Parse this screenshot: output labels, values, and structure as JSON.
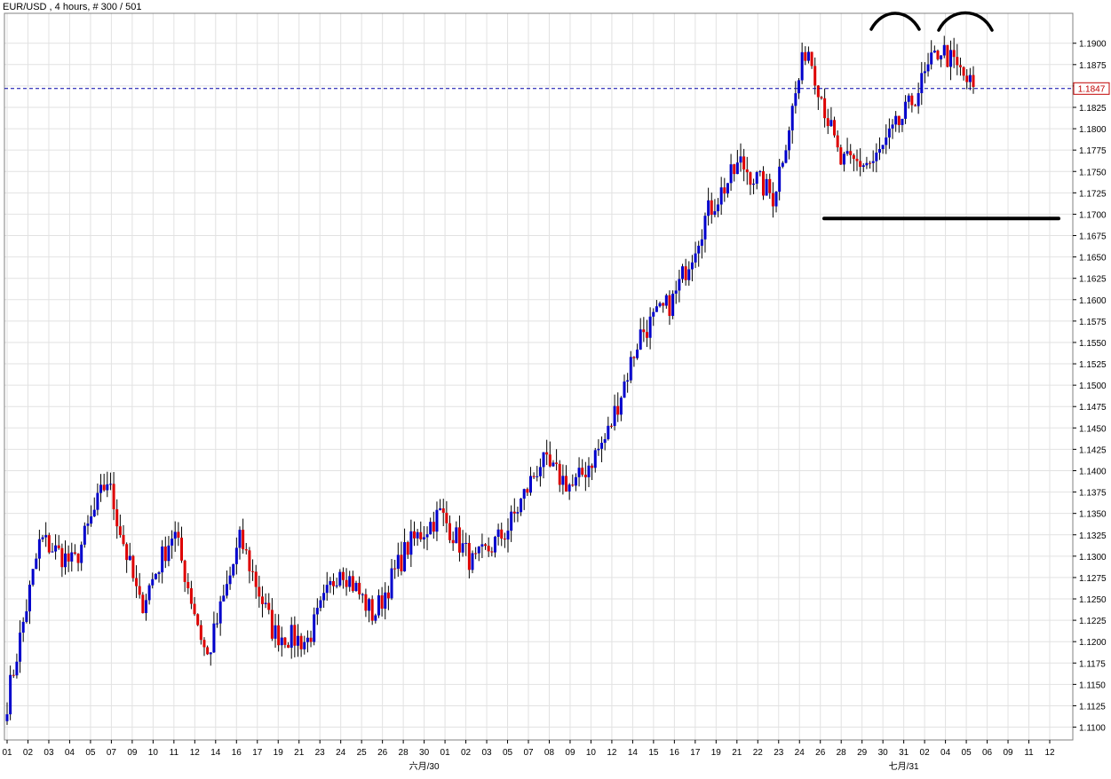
{
  "chart_data": {
    "type": "candlestick",
    "title": "EUR/USD , 4 hours, # 300 / 501",
    "symbol": "EUR/USD",
    "timeframe": "4 hours",
    "bars_info": "# 300 / 501",
    "ylim": [
      1.1085,
      1.1935
    ],
    "y_ticks": [
      "1.1900",
      "1.1875",
      "1.1850",
      "1.1825",
      "1.1800",
      "1.1775",
      "1.1750",
      "1.1725",
      "1.1700",
      "1.1675",
      "1.1650",
      "1.1625",
      "1.1600",
      "1.1575",
      "1.1550",
      "1.1525",
      "1.1500",
      "1.1475",
      "1.1450",
      "1.1425",
      "1.1400",
      "1.1375",
      "1.1350",
      "1.1325",
      "1.1300",
      "1.1275",
      "1.1250",
      "1.1225",
      "1.1200",
      "1.1175",
      "1.1150",
      "1.1125",
      "1.1100"
    ],
    "x_tick_labels": [
      "01",
      "02",
      "03",
      "04",
      "05",
      "07",
      "09",
      "10",
      "11",
      "12",
      "14",
      "16",
      "17",
      "19",
      "21",
      "23",
      "24",
      "25",
      "26",
      "28",
      "30",
      "01",
      "02",
      "03",
      "05",
      "07",
      "08",
      "09",
      "10",
      "12",
      "14",
      "15",
      "16",
      "17",
      "19",
      "21",
      "22",
      "23",
      "24",
      "26",
      "28",
      "29",
      "30",
      "31",
      "02",
      "04",
      "05",
      "06",
      "09",
      "11",
      "12"
    ],
    "month_labels": [
      "六月/30",
      "七月/31"
    ],
    "current_price": "1.1847",
    "current_price_value": 1.1847,
    "support_line_level": 1.1695,
    "annotations": [
      "double-top-arc-1",
      "double-top-arc-2",
      "neckline-support"
    ],
    "up_color": "#0000cc",
    "down_color": "#dd0000",
    "grid": true,
    "key_points": [
      {
        "x": "01",
        "y": 1.113
      },
      {
        "x": "05",
        "y": 1.132
      },
      {
        "x": "09",
        "y": 1.129
      },
      {
        "x": "11",
        "y": 1.139
      },
      {
        "x": "14",
        "y": 1.124
      },
      {
        "x": "16",
        "y": 1.133
      },
      {
        "x": "21",
        "y": 1.118
      },
      {
        "x": "24",
        "y": 1.132
      },
      {
        "x": "26",
        "y": 1.121
      },
      {
        "x": "30",
        "y": 1.12
      },
      {
        "x": "01",
        "y": 1.129
      },
      {
        "x": "05",
        "y": 1.123
      },
      {
        "x": "07",
        "y": 1.131
      },
      {
        "x": "09",
        "y": 1.135
      },
      {
        "x": "12",
        "y": 1.129
      },
      {
        "x": "14",
        "y": 1.133
      },
      {
        "x": "16",
        "y": 1.141
      },
      {
        "x": "17",
        "y": 1.138
      },
      {
        "x": "21",
        "y": 1.144
      },
      {
        "x": "22",
        "y": 1.156
      },
      {
        "x": "24",
        "y": 1.16
      },
      {
        "x": "26",
        "y": 1.17
      },
      {
        "x": "28",
        "y": 1.176
      },
      {
        "x": "29",
        "y": 1.172
      },
      {
        "x": "31",
        "y": 1.19
      },
      {
        "x": "02",
        "y": 1.176
      },
      {
        "x": "04",
        "y": 1.176
      },
      {
        "x": "05",
        "y": 1.182
      },
      {
        "x": "06",
        "y": 1.1895
      },
      {
        "x": "06",
        "y": 1.1847
      }
    ]
  }
}
